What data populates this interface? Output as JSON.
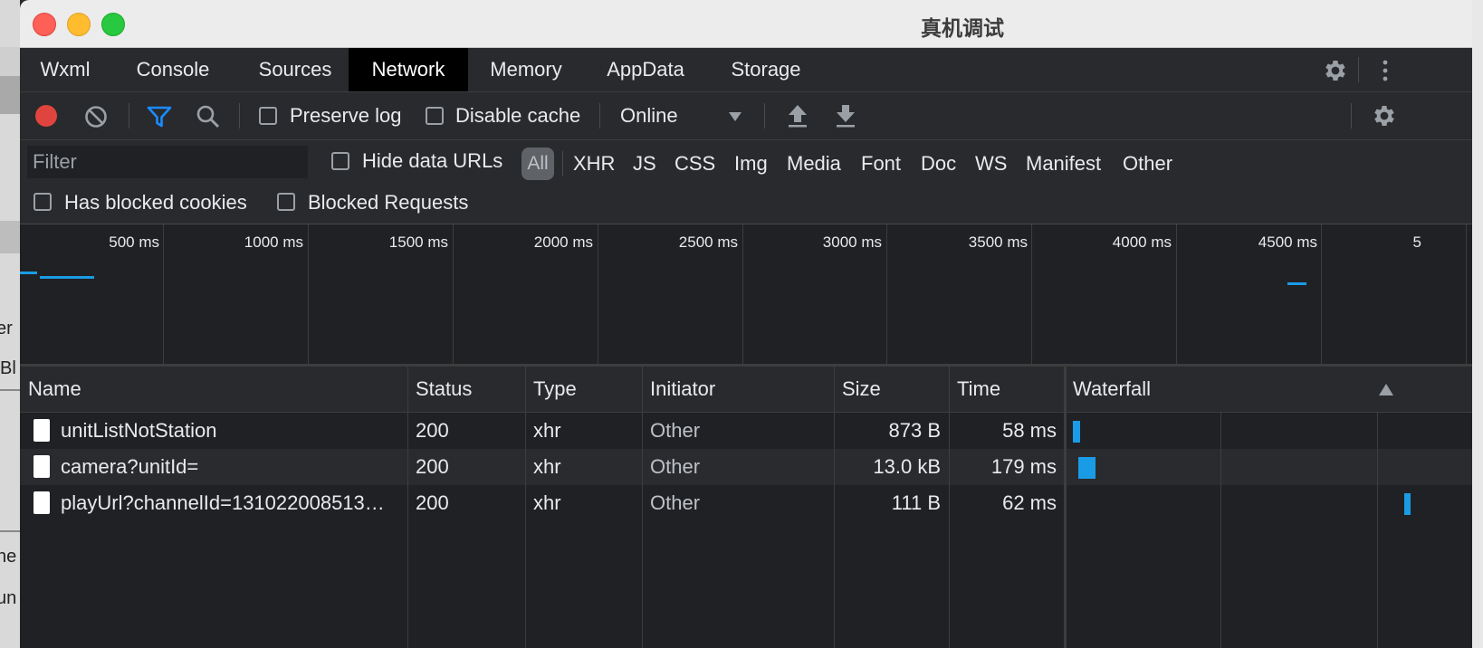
{
  "window": {
    "title": "真机调试"
  },
  "background_fragments": [
    "er",
    "Bl",
    "ne",
    "un"
  ],
  "tabs": [
    "Wxml",
    "Console",
    "Sources",
    "Network",
    "Memory",
    "AppData",
    "Storage"
  ],
  "active_tab": "Network",
  "toolbar": {
    "preserve_log": "Preserve log",
    "disable_cache": "Disable cache",
    "throttling": "Online"
  },
  "filter": {
    "placeholder": "Filter",
    "hide_data_urls": "Hide data URLs",
    "all_label": "All",
    "types": [
      "XHR",
      "JS",
      "CSS",
      "Img",
      "Media",
      "Font",
      "Doc",
      "WS",
      "Manifest",
      "Other"
    ],
    "has_blocked_cookies": "Has blocked cookies",
    "blocked_requests": "Blocked Requests"
  },
  "overview": {
    "ticks": [
      "500 ms",
      "1000 ms",
      "1500 ms",
      "2000 ms",
      "2500 ms",
      "3000 ms",
      "3500 ms",
      "4000 ms",
      "4500 ms",
      "5"
    ]
  },
  "table": {
    "columns": [
      "Name",
      "Status",
      "Type",
      "Initiator",
      "Size",
      "Time",
      "Waterfall"
    ],
    "rows": [
      {
        "name": "unitListNotStation",
        "status": "200",
        "type": "xhr",
        "initiator": "Other",
        "size": "873 B",
        "time": "58 ms"
      },
      {
        "name": "camera?unitId=",
        "status": "200",
        "type": "xhr",
        "initiator": "Other",
        "size": "13.0 kB",
        "time": "179 ms"
      },
      {
        "name": "playUrl?channelId=131022008513…",
        "status": "200",
        "type": "xhr",
        "initiator": "Other",
        "size": "111 B",
        "time": "62 ms"
      }
    ]
  },
  "colors": {
    "record_red": "#e0443e",
    "filter_blue": "#1a8cff",
    "waterfall_blue": "#1a9be6"
  }
}
